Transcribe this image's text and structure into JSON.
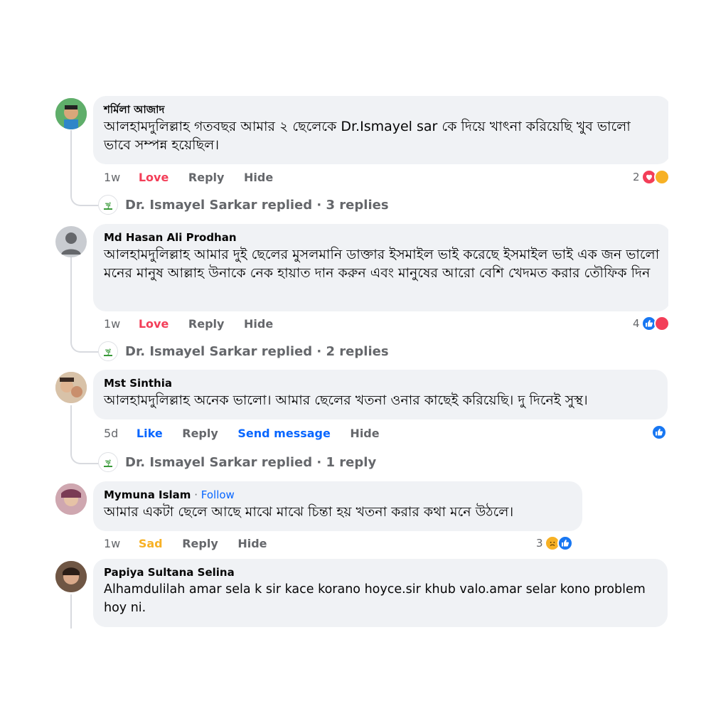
{
  "comments": [
    {
      "author": "শর্মিলা আজাদ",
      "text": "আলহামদুলিল্লাহ গতবছর আমার ২ ছেলেকে Dr.Ismayel sar কে দিয়ে খাৎনা করিয়েছি খুব ভালো ভাবে সম্পন্ন হয়েছিল।",
      "time": "1w",
      "reaction_label": "Love",
      "reply_label": "Reply",
      "hide_label": "Hide",
      "reaction_count": "2",
      "reaction_icons": [
        "love-icon",
        "haha-icon"
      ],
      "replies_summary": {
        "author": "Dr. Ismayel Sarkar",
        "text": "Dr. Ismayel Sarkar replied · 3 replies"
      }
    },
    {
      "author": "Md Hasan Ali Prodhan",
      "text": "আলহামদুলিল্লাহ আমার দুই ছেলের মুসলমানি ডাক্তার ইসমাইল ভাই করেছে ইসমাইল ভাই এক জন ভালো মনের মানুষ আল্লাহ উনাকে নেক হায়াত দান করুন এবং মানুষের আরো বেশি খেদমত করার তৌফিক দিন",
      "time": "1w",
      "reaction_label": "Love",
      "reply_label": "Reply",
      "hide_label": "Hide",
      "reaction_count": "4",
      "reaction_icons": [
        "like-icon",
        "love-icon"
      ],
      "replies_summary": {
        "author": "Dr. Ismayel Sarkar",
        "text": "Dr. Ismayel Sarkar replied · 2 replies"
      }
    },
    {
      "author": "Mst Sinthia",
      "text": "আলহামদুলিল্লাহ অনেক ভালো। আমার ছেলের খতনা ওনার কাছেই করিয়েছি। দু দিনেই সুস্থ।",
      "time": "5d",
      "reaction_label": "Like",
      "reply_label": "Reply",
      "send_label": "Send message",
      "hide_label": "Hide",
      "reaction_icons": [
        "like-icon"
      ],
      "replies_summary": {
        "author": "Dr. Ismayel Sarkar",
        "text": "Dr. Ismayel Sarkar replied · 1 reply"
      }
    },
    {
      "author": "Mymuna Islam",
      "follow": "Follow",
      "follow_sep": " · ",
      "text": "আমার একটা ছেলে আছে মাঝে মাঝে চিন্তা হয় খতনা করার কথা মনে উঠলে।",
      "time": "1w",
      "reaction_label": "Sad",
      "reply_label": "Reply",
      "hide_label": "Hide",
      "reaction_count": "3",
      "reaction_icons": [
        "sad-icon",
        "like-icon"
      ]
    },
    {
      "author": "Papiya Sultana Selina",
      "text": "Alhamdulilah amar sela k sir kace korano hoyce.sir khub valo.amar selar kono problem hoy ni."
    }
  ],
  "colors": {
    "bubble": "#f0f2f5",
    "love": "#f33e58",
    "like": "#0866ff",
    "sad": "#f7b125",
    "meta": "#65676b"
  }
}
